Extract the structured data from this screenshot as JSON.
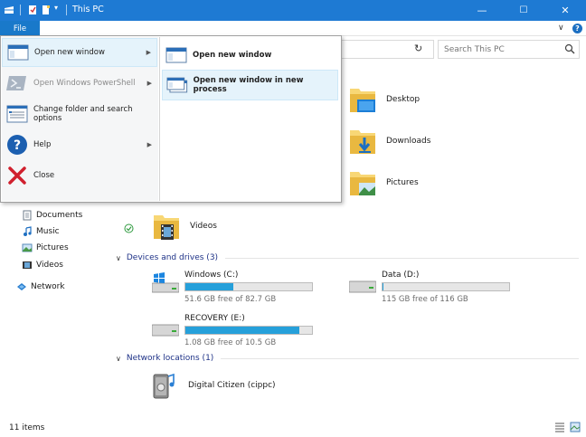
{
  "window": {
    "title": "This PC",
    "minimize_glyph": "—",
    "maximize_glyph": "☐",
    "close_glyph": "✕"
  },
  "ribbon": {
    "file_tab": "File",
    "collapse_glyph": "∨",
    "help_glyph": "?"
  },
  "toolbar": {
    "refresh_glyph": "↻",
    "search_placeholder": "Search This PC"
  },
  "file_menu": {
    "items": [
      {
        "label": "Open new window",
        "icon": "window-icon",
        "has_submenu": true,
        "highlighted": true
      },
      {
        "label": "Open Windows PowerShell",
        "icon": "powershell-icon",
        "has_submenu": true,
        "disabled": true
      },
      {
        "label": "Change folder and search options",
        "icon": "folder-options-icon",
        "has_submenu": false
      },
      {
        "label": "Help",
        "icon": "help-icon",
        "has_submenu": true
      },
      {
        "label": "Close",
        "icon": "close-x-icon",
        "has_submenu": false
      }
    ],
    "submenu": [
      {
        "label": "Open new window",
        "icon": "window-icon"
      },
      {
        "label": "Open new window in new process",
        "icon": "window-process-icon",
        "highlighted": true
      }
    ]
  },
  "nav": {
    "items": [
      {
        "label": "Documents",
        "icon": "documents-icon"
      },
      {
        "label": "Music",
        "icon": "music-icon"
      },
      {
        "label": "Pictures",
        "icon": "pictures-icon"
      },
      {
        "label": "Videos",
        "icon": "videos-icon"
      },
      {
        "label": "Network",
        "icon": "network-icon"
      }
    ]
  },
  "folders": [
    {
      "label": "Desktop",
      "icon": "desktop-folder-icon"
    },
    {
      "label": "Downloads",
      "icon": "downloads-folder-icon"
    },
    {
      "label": "Pictures",
      "icon": "pictures-folder-icon"
    },
    {
      "label": "Videos",
      "icon": "videos-folder-icon",
      "status": "synced-check"
    }
  ],
  "sections": {
    "devices": "Devices and drives (3)",
    "network": "Network locations (1)"
  },
  "drives": [
    {
      "name": "Windows (C:)",
      "free": "51.6 GB free of 82.7 GB",
      "used_fraction": 0.376,
      "icon": "windows-drive-icon",
      "bar_color": "#26a0da"
    },
    {
      "name": "Data (D:)",
      "free": "115 GB free of 116 GB",
      "used_fraction": 0.01,
      "icon": "drive-icon",
      "bar_color": "#26a0da"
    },
    {
      "name": "RECOVERY (E:)",
      "free": "1.08 GB free of 10.5 GB",
      "used_fraction": 0.897,
      "icon": "drive-icon",
      "bar_color": "#26a0da"
    }
  ],
  "network_locations": [
    {
      "label": "Digital Citizen (cippc)",
      "icon": "media-server-icon"
    }
  ],
  "status_bar": {
    "items_count": "11 items"
  },
  "colors": {
    "titlebar": "#1e7ad3",
    "accent": "#1979ca",
    "section_header": "#1e3287",
    "menu_highlight": "#e5f3fb"
  }
}
